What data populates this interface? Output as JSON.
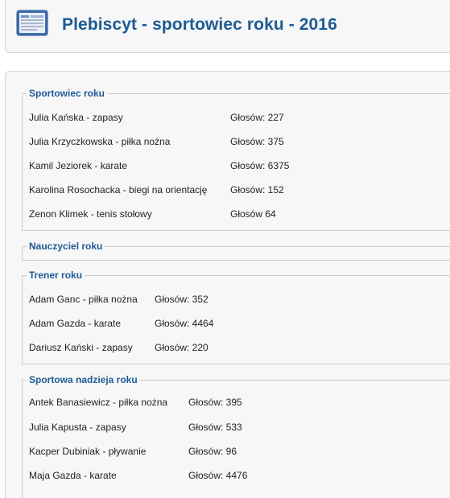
{
  "header": {
    "title": "Plebiscyt - sportowiec roku - 2016",
    "icon": "list-document-icon"
  },
  "sections": [
    {
      "legend": "Sportowiec roku",
      "entries": [
        {
          "name": "Julia Kańska - zapasy",
          "votes": "Głosów: 227"
        },
        {
          "name": "Julia Krzyczkowska - piłka nożna",
          "votes": "Głosów: 375"
        },
        {
          "name": "Kamil Jeziorek - karate",
          "votes": "Głosów: 6375"
        },
        {
          "name": "Karolina Rosochacka - biegi na orientację",
          "votes": "Głosów: 152"
        },
        {
          "name": "Zenon Klimek - tenis stołowy",
          "votes": "Głosów  64"
        }
      ]
    },
    {
      "legend": "Nauczyciel roku",
      "entries": []
    },
    {
      "legend": "Trener roku",
      "entries": [
        {
          "name": "Adam Ganc - piłka nożna",
          "votes": "Głosów: 352"
        },
        {
          "name": "Adam Gazda - karate",
          "votes": "Głosów: 4464"
        },
        {
          "name": "Dariusz Kański - zapasy",
          "votes": "Głosów: 220"
        }
      ]
    },
    {
      "legend": "Sportowa nadzieja roku",
      "entries": [
        {
          "name": "Antek Banasiewicz - piłka nożna",
          "votes": "Głosów: 395"
        },
        {
          "name": "Julia Kapusta - zapasy",
          "votes": "Głosów: 533"
        },
        {
          "name": "Kacper Dubiniak - pływanie",
          "votes": "Głosów: 96"
        },
        {
          "name": "Maja Gazda - karate",
          "votes": "Głosów: 4476"
        }
      ]
    }
  ]
}
